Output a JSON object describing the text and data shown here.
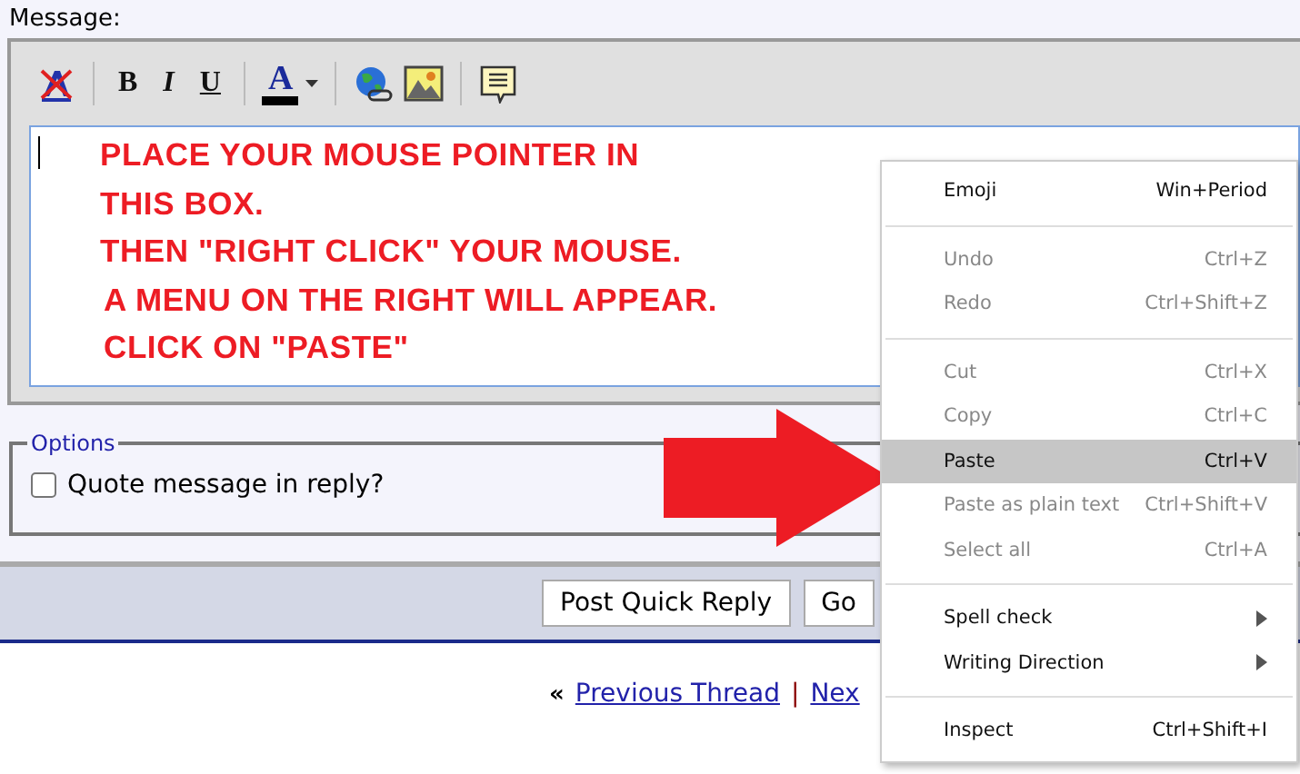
{
  "message_label": "Message:",
  "toolbar": {
    "format_buttons": [
      {
        "label": "B",
        "kind": "bold"
      },
      {
        "label": "I",
        "kind": "italic"
      },
      {
        "label": "U",
        "kind": "underline"
      }
    ],
    "font_color_label": "A"
  },
  "editor_lines": [
    "PLACE YOUR MOUSE POINTER IN",
    "THIS BOX.",
    "THEN \"RIGHT CLICK\" YOUR MOUSE.",
    "A MENU ON THE RIGHT WILL APPEAR.",
    "CLICK ON \"PASTE\""
  ],
  "options": {
    "legend": "Options",
    "checkbox": {
      "label": "Quote message in reply?",
      "checked": false
    }
  },
  "buttons": [
    "Post Quick Reply",
    "Go"
  ],
  "thread_nav": {
    "prefix": "«",
    "previous": "Previous Thread",
    "separator": "|",
    "next": "Nex"
  },
  "context_menu": [
    {
      "kind": "item",
      "label": "Emoji",
      "shortcut": "Win+Period",
      "disabled": false,
      "selected": false
    },
    {
      "kind": "separator"
    },
    {
      "kind": "item",
      "label": "Undo",
      "shortcut": "Ctrl+Z",
      "disabled": true,
      "selected": false
    },
    {
      "kind": "item",
      "label": "Redo",
      "shortcut": "Ctrl+Shift+Z",
      "disabled": true,
      "selected": false
    },
    {
      "kind": "separator"
    },
    {
      "kind": "item",
      "label": "Cut",
      "shortcut": "Ctrl+X",
      "disabled": true,
      "selected": false
    },
    {
      "kind": "item",
      "label": "Copy",
      "shortcut": "Ctrl+C",
      "disabled": true,
      "selected": false
    },
    {
      "kind": "item",
      "label": "Paste",
      "shortcut": "Ctrl+V",
      "disabled": false,
      "selected": true
    },
    {
      "kind": "item",
      "label": "Paste as plain text",
      "shortcut": "Ctrl+Shift+V",
      "disabled": true,
      "selected": false
    },
    {
      "kind": "item",
      "label": "Select all",
      "shortcut": "Ctrl+A",
      "disabled": true,
      "selected": false
    },
    {
      "kind": "separator"
    },
    {
      "kind": "submenu",
      "label": "Spell check",
      "disabled": false,
      "selected": false
    },
    {
      "kind": "submenu",
      "label": "Writing Direction",
      "disabled": false,
      "selected": false
    },
    {
      "kind": "separator"
    },
    {
      "kind": "item",
      "label": "Inspect",
      "shortcut": "Ctrl+Shift+I",
      "disabled": false,
      "selected": false
    }
  ]
}
